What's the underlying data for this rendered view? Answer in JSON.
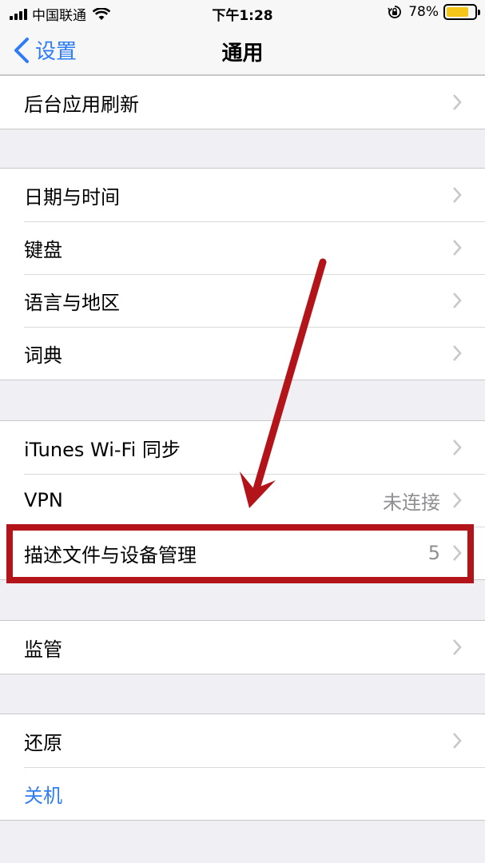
{
  "status_bar": {
    "carrier": "中国联通",
    "time": "下午1:28",
    "battery_percent": "78%",
    "battery_level": 0.78,
    "icons": [
      "signal-icon",
      "wifi-icon",
      "rotation-lock-icon",
      "battery-icon"
    ]
  },
  "nav": {
    "back_label": "设置",
    "title": "通用"
  },
  "groups": {
    "g1": {
      "rows": [
        {
          "label": "后台应用刷新"
        }
      ]
    },
    "g2": {
      "rows": [
        {
          "label": "日期与时间"
        },
        {
          "label": "键盘"
        },
        {
          "label": "语言与地区"
        },
        {
          "label": "词典"
        }
      ]
    },
    "g3": {
      "rows": [
        {
          "label": "iTunes Wi-Fi 同步"
        },
        {
          "label": "VPN",
          "value": "未连接"
        },
        {
          "label": "描述文件与设备管理",
          "value": "5"
        }
      ]
    },
    "g4": {
      "rows": [
        {
          "label": "监管"
        }
      ]
    },
    "g5": {
      "rows": [
        {
          "label": "还原"
        },
        {
          "label": "关机"
        }
      ]
    }
  },
  "colors": {
    "accent": "#2e7cf6",
    "annotation_red": "#b2141a",
    "background": "#efeff4"
  }
}
